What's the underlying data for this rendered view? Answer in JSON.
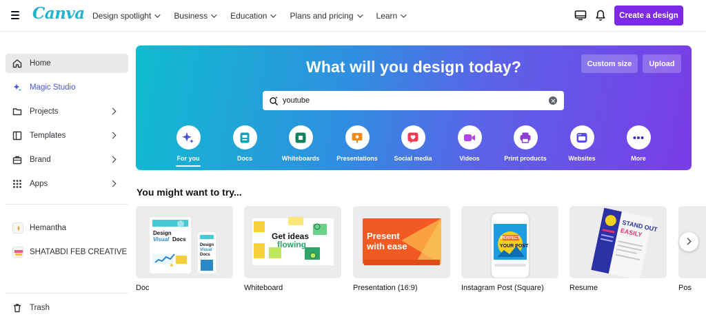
{
  "header": {
    "logo": "Canva",
    "nav": [
      {
        "label": "Design spotlight"
      },
      {
        "label": "Business"
      },
      {
        "label": "Education"
      },
      {
        "label": "Plans and pricing"
      },
      {
        "label": "Learn"
      }
    ],
    "create_label": "Create a design"
  },
  "sidebar": {
    "items": [
      {
        "label": "Home",
        "icon": "home-icon"
      },
      {
        "label": "Magic Studio",
        "icon": "sparkle-icon"
      },
      {
        "label": "Projects",
        "icon": "folder-icon"
      },
      {
        "label": "Templates",
        "icon": "templates-icon"
      },
      {
        "label": "Brand",
        "icon": "briefcase-icon"
      },
      {
        "label": "Apps",
        "icon": "apps-grid-icon"
      }
    ],
    "teams": [
      {
        "label": "Hemantha"
      },
      {
        "label": "SHATABDI FEB CREATIVE"
      }
    ],
    "trash_label": "Trash"
  },
  "hero": {
    "title": "What will you design today?",
    "custom_size_label": "Custom size",
    "upload_label": "Upload",
    "search_value": "youtube",
    "categories": [
      {
        "label": "For you",
        "icon": "sparkle-icon"
      },
      {
        "label": "Docs",
        "icon": "doc-icon"
      },
      {
        "label": "Whiteboards",
        "icon": "whiteboard-icon"
      },
      {
        "label": "Presentations",
        "icon": "presentation-icon"
      },
      {
        "label": "Social media",
        "icon": "heart-icon"
      },
      {
        "label": "Videos",
        "icon": "video-icon"
      },
      {
        "label": "Print products",
        "icon": "print-icon"
      },
      {
        "label": "Websites",
        "icon": "website-icon"
      },
      {
        "label": "More",
        "icon": "more-icon"
      }
    ]
  },
  "suggestions": {
    "title": "You might want to try...",
    "cards": [
      {
        "label": "Doc",
        "thumb_text": "Design Visual Docs"
      },
      {
        "label": "Whiteboard",
        "thumb_text": "Get ideas flowing"
      },
      {
        "label": "Presentation (16:9)",
        "thumb_text": "Present with ease"
      },
      {
        "label": "Instagram Post (Square)",
        "thumb_text": "PERFECT YOUR POST"
      },
      {
        "label": "Resume",
        "thumb_text": "STAND OUT EASILY"
      },
      {
        "label": "Pos"
      }
    ]
  },
  "colors": {
    "brand": "#7d2ae8",
    "logo": "#22b3cf",
    "hero_start": "#0fbccf",
    "hero_end": "#7a3ce7"
  }
}
